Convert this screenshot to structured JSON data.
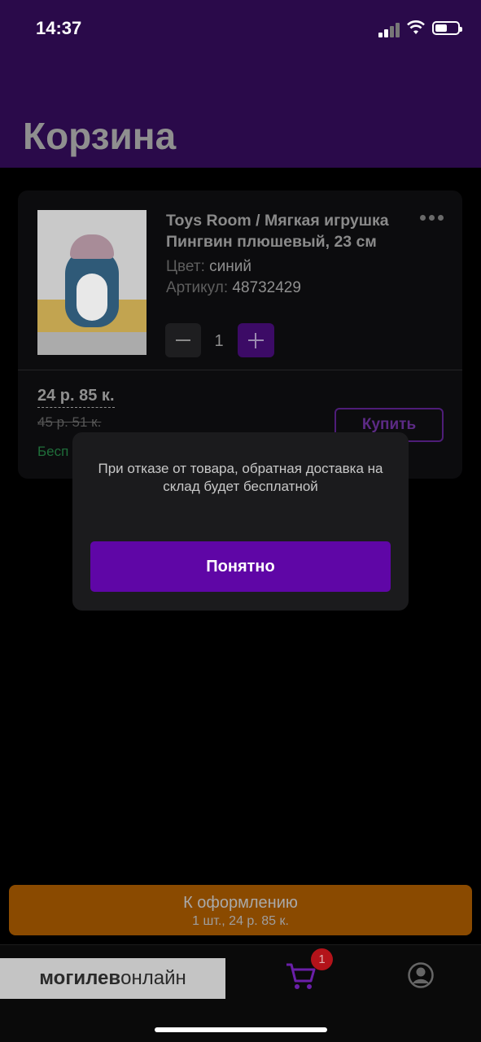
{
  "status_bar": {
    "time": "14:37"
  },
  "header": {
    "title": "Корзина"
  },
  "cart_item": {
    "title": "Toys Room / Мягкая игрушка Пингвин плюшевый, 23 см",
    "color_label": "Цвет:",
    "color_value": "синий",
    "sku_label": "Артикул:",
    "sku_value": "48732429",
    "quantity": "1",
    "price": "24 р. 85 к.",
    "old_price": "45 р. 51 к.",
    "delivery_note": "Бесп",
    "buy_label": "Купить"
  },
  "dialog": {
    "message": "При отказе от товара, обратная доставка на склад будет бесплатной",
    "button_label": "Понятно"
  },
  "checkout": {
    "label": "К оформлению",
    "summary": "1 шт., 24 р. 85 к."
  },
  "tabbar": {
    "cart_badge": "1",
    "watermark_bold": "могилев",
    "watermark_light": "онлайн"
  },
  "colors": {
    "header_bg": "#2a0a4a",
    "accent_purple": "#5f06a6",
    "checkout_orange": "#8a4a00",
    "badge_red": "#b3131a"
  }
}
